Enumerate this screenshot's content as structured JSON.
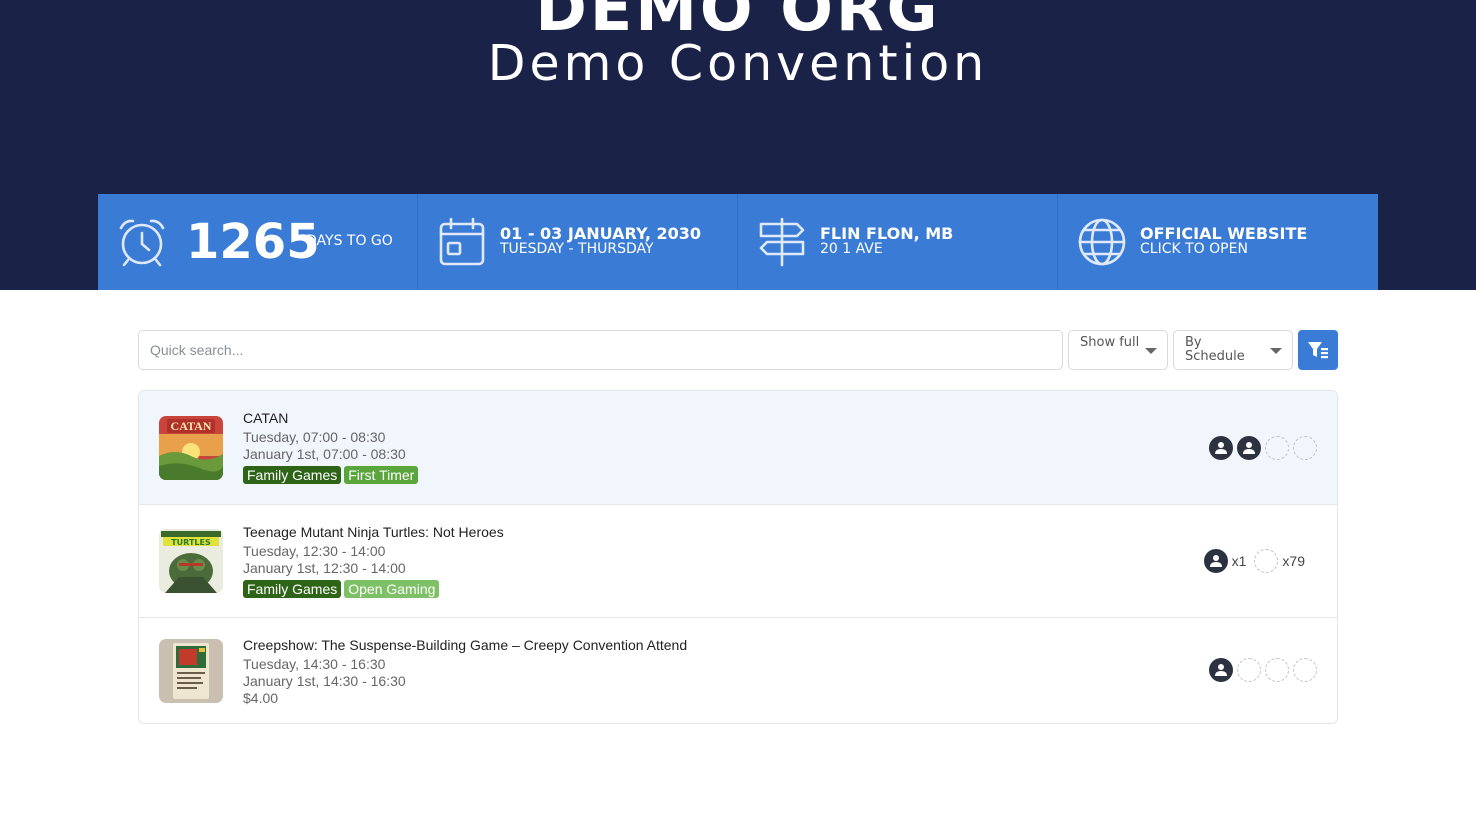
{
  "header": {
    "org_name": "DEMO ORG",
    "convention_name": "Demo Convention"
  },
  "info_bar": {
    "countdown": {
      "number": "1265",
      "label": "DAYS TO GO",
      "icon": "alarm-clock-icon"
    },
    "dates": {
      "main": "01 - 03 JANUARY, 2030",
      "sub": "TUESDAY - THURSDAY",
      "icon": "calendar-icon"
    },
    "location": {
      "main": "FLIN FLON, MB",
      "sub": "20 1 AVE",
      "icon": "signpost-icon"
    },
    "website": {
      "main": "OFFICIAL WEBSITE",
      "sub": "CLICK TO OPEN",
      "icon": "globe-icon"
    },
    "bar_color": "#3a7bd5"
  },
  "toolbar": {
    "search_placeholder": "Quick search...",
    "show_select": {
      "value": "Show full"
    },
    "sort_select": {
      "value": "By Schedule"
    },
    "filter_icon": "filter-icon"
  },
  "events": [
    {
      "title": "CATAN",
      "line1": "Tuesday, 07:00 - 08:30",
      "line2": "January 1st, 07:00 - 08:30",
      "tags": [
        "Family Games",
        "First Timer"
      ],
      "seats_filled": 2,
      "seats_empty": 2
    },
    {
      "title": "Teenage Mutant Ninja Turtles: Not Heroes",
      "line1": "Tuesday, 12:30 - 14:00",
      "line2": "January 1st, 12:30 - 14:00",
      "tags": [
        "Family Games",
        "Open Gaming"
      ],
      "filled_count": "x1",
      "empty_count": "x79"
    },
    {
      "title": "Creepshow: The Suspense-Building Game – Creepy Convention Attend",
      "line1": "Tuesday, 14:30 - 16:30",
      "line2": "January 1st, 14:30 - 16:30",
      "price": "$4.00",
      "seats_filled": 1,
      "seats_empty": 3
    }
  ],
  "colors": {
    "hero_bg": "#1b2248",
    "tag_dark": "#2e6417",
    "tag_light": "#5aa63c",
    "tag_pale": "#7ec065"
  }
}
